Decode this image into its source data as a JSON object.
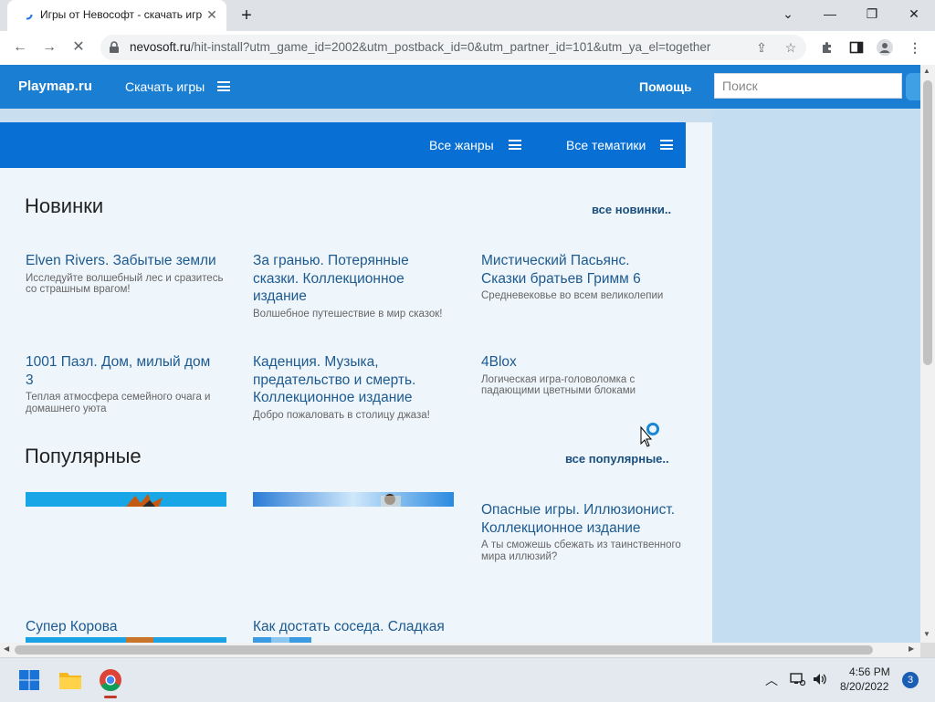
{
  "browser": {
    "tab_title": "Игры от Невософт - скачать игр",
    "url_host": "nevosoft.ru",
    "url_path": "/hit-install?utm_game_id=2002&utm_postback_id=0&utm_partner_id=101&utm_ya_el=together"
  },
  "header": {
    "logo": "Playmap.ru",
    "download_games": "Скачать игры",
    "help": "Помощь",
    "search_placeholder": "Поиск"
  },
  "filters": {
    "all_genres": "Все жанры",
    "all_themes": "Все тематики"
  },
  "new_section": {
    "title": "Новинки",
    "more": "все новинки..",
    "games": [
      {
        "title": "Elven Rivers. Забытые земли",
        "desc": "Исследуйте волшебный лес и сразитесь со страшным врагом!"
      },
      {
        "title": "За гранью. Потерянные сказки. Коллекционное издание",
        "desc": "Волшебное путешествие в мир сказок!"
      },
      {
        "title": "Мистический Пасьянс. Сказки братьев Гримм 6",
        "desc": "Средневековье во всем великолепии"
      },
      {
        "title": "1001 Пазл. Дом, милый дом 3",
        "desc": "Теплая атмосфера семейного очага и домашнего уюта"
      },
      {
        "title": "Каденция. Музыка, предательство и смерть. Коллекционное издание",
        "desc": "Добро пожаловать в столицу джаза!"
      },
      {
        "title": "4Blox",
        "desc": "Логическая игра-головоломка с падающими цветными блоками"
      }
    ]
  },
  "popular_section": {
    "title": "Популярные",
    "more": "все популярные..",
    "games": [
      {
        "title": "Опасные игры. Иллюзионист. Коллекционное издание",
        "desc": "А ты сможешь сбежать из таинственного мира иллюзий?"
      },
      {
        "title": "Супер Корова",
        "desc": ""
      },
      {
        "title": "Как достать соседа. Сладкая",
        "desc": ""
      }
    ]
  },
  "taskbar": {
    "time": "4:56 PM",
    "date": "8/20/2022",
    "notifications": "3"
  },
  "colors": {
    "site_header": "#1a7fd3",
    "genre_bar": "#0870d4",
    "link": "#1d5a8f",
    "page_bg": "#eef5fb"
  }
}
